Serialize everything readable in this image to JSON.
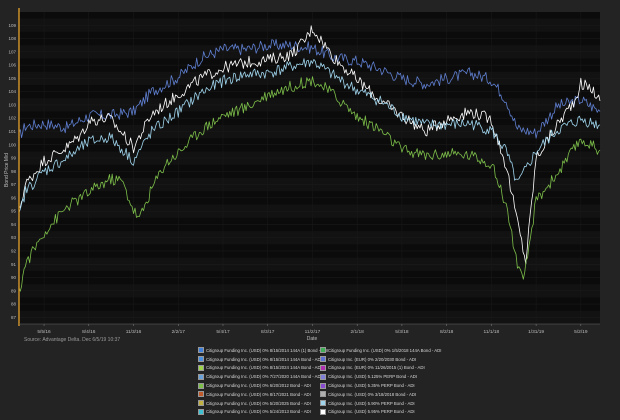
{
  "source_text": "Source: Advantage Delta. Dec 6/5/19 10:37",
  "chart_data": {
    "type": "line",
    "ylabel": "Bond Price Mid",
    "xlabel": "Date",
    "ylim": [
      86.5,
      110
    ],
    "y_ticks": [
      87,
      88,
      89,
      90,
      91,
      92,
      93,
      94,
      95,
      96,
      97,
      98,
      99,
      100,
      101,
      102,
      103,
      104,
      105,
      106,
      107,
      108,
      109
    ],
    "x_tick_labels": [
      "5/5/16",
      "8/4/16",
      "11/3/16",
      "2/2/17",
      "5/4/17",
      "8/3/17",
      "11/2/17",
      "2/1/18",
      "5/3/18",
      "8/2/18",
      "11/1/18",
      "1/31/19",
      "5/2/19"
    ],
    "x_range": [
      "3/15/16",
      "6/10/19"
    ],
    "grid": true,
    "series": [
      {
        "color": "#5f7fd0",
        "x": [
          "3/15/16",
          "3/28/16",
          "5/5/16",
          "6/20/16",
          "8/4/16",
          "9/15/16",
          "11/3/16",
          "12/10/16",
          "2/2/17",
          "3/20/17",
          "5/4/17",
          "6/20/17",
          "8/3/17",
          "9/20/17",
          "11/2/17",
          "12/15/17",
          "2/1/18",
          "3/20/18",
          "5/3/18",
          "6/20/18",
          "8/2/18",
          "9/20/18",
          "11/1/18",
          "12/1/18",
          "12/24/18",
          "1/31/19",
          "3/15/19",
          "5/2/19",
          "6/10/19"
        ],
        "values": [
          100.6,
          101.4,
          101.6,
          101.3,
          102.2,
          102.2,
          102.5,
          104.0,
          105.1,
          106.5,
          107.2,
          107.2,
          107.5,
          107.5,
          107.3,
          106.6,
          106.3,
          105.7,
          105.0,
          104.6,
          105.0,
          105.4,
          104.9,
          103.4,
          101.2,
          100.9,
          102.9,
          103.4,
          102.5
        ]
      },
      {
        "color": "#ffffff",
        "x": [
          "3/15/16",
          "3/28/16",
          "5/5/16",
          "6/20/16",
          "7/20/16",
          "8/4/16",
          "9/15/16",
          "10/10/16",
          "11/3/16",
          "12/10/16",
          "2/2/17",
          "3/20/17",
          "5/4/17",
          "6/20/17",
          "8/3/17",
          "9/20/17",
          "10/20/17",
          "11/2/17",
          "12/15/17",
          "2/1/18",
          "3/20/18",
          "5/3/18",
          "6/20/18",
          "8/2/18",
          "9/20/18",
          "11/1/18",
          "12/1/18",
          "12/24/18",
          "1/10/19",
          "1/31/19",
          "3/15/19",
          "4/20/19",
          "5/2/19",
          "5/25/19",
          "6/10/19"
        ],
        "values": [
          95.0,
          97.0,
          98.8,
          99.8,
          100.8,
          101.8,
          102.0,
          100.9,
          99.8,
          102.3,
          103.8,
          105.0,
          105.8,
          106.2,
          106.4,
          106.8,
          108.0,
          108.8,
          106.6,
          104.9,
          103.3,
          102.2,
          101.0,
          101.9,
          102.5,
          101.9,
          98.4,
          94.2,
          91.2,
          99.0,
          101.5,
          103.4,
          104.6,
          104.2,
          103.3
        ]
      },
      {
        "color": "#9fd4ec",
        "x": [
          "3/15/16",
          "3/28/16",
          "5/5/16",
          "6/20/16",
          "8/4/16",
          "9/15/16",
          "10/10/16",
          "11/3/16",
          "12/10/16",
          "2/2/17",
          "3/20/17",
          "5/4/17",
          "6/20/17",
          "8/3/17",
          "9/20/17",
          "11/2/17",
          "12/15/17",
          "2/1/18",
          "3/20/18",
          "5/3/18",
          "6/20/18",
          "8/2/18",
          "9/20/18",
          "11/1/18",
          "12/1/18",
          "12/24/18",
          "1/31/19",
          "3/15/19",
          "5/2/19",
          "6/10/19"
        ],
        "values": [
          94.5,
          96.5,
          98.0,
          99.0,
          100.2,
          100.6,
          99.7,
          98.8,
          101.0,
          102.5,
          103.9,
          104.8,
          105.3,
          105.4,
          105.9,
          106.3,
          105.2,
          104.1,
          103.3,
          102.2,
          101.5,
          101.5,
          101.6,
          101.1,
          99.5,
          97.0,
          99.5,
          101.1,
          101.9,
          101.5
        ]
      },
      {
        "color": "#7dbf4a",
        "x": [
          "3/15/16",
          "3/28/16",
          "5/5/16",
          "6/20/16",
          "8/4/16",
          "9/15/16",
          "10/10/16",
          "11/3/16",
          "11/15/16",
          "12/10/16",
          "1/5/17",
          "2/2/17",
          "3/20/17",
          "5/4/17",
          "6/20/17",
          "8/3/17",
          "9/20/17",
          "11/2/17",
          "12/15/17",
          "2/1/18",
          "3/20/18",
          "5/3/18",
          "6/20/18",
          "8/2/18",
          "9/20/18",
          "11/1/18",
          "12/1/18",
          "12/24/18",
          "1/5/19",
          "1/31/19",
          "3/15/19",
          "5/2/19",
          "5/25/19",
          "6/10/19"
        ],
        "values": [
          88.8,
          91.0,
          93.4,
          95.3,
          96.4,
          97.4,
          97.3,
          95.1,
          94.4,
          96.7,
          98.5,
          99.4,
          101.1,
          102.2,
          102.8,
          103.8,
          104.4,
          104.9,
          103.8,
          102.1,
          101.1,
          99.6,
          99.2,
          99.3,
          99.2,
          98.6,
          95.5,
          91.0,
          89.5,
          95.8,
          97.8,
          100.4,
          99.9,
          99.6
        ]
      }
    ]
  },
  "legend": [
    [
      "Citigroup Funding Inc. (USD) 0% 8/15/2014 144A (1) Bond - ADI",
      "Citigroup Funding Inc. (USD) 0% 1/5/2018 144A Bond - ADI"
    ],
    [
      "Citigroup Funding Inc. (USD) 0% 8/15/2014 144A Bond - ADI",
      "Citigroup Inc. (EUR) 0% 2/20/2030 Bond - ADI"
    ],
    [
      "Citigroup Funding Inc. (USD) 0% 8/15/2024 144A Bond - ADI",
      "Citigroup Inc. (EUR) 0% 11/26/2015 (1) Bond - ADI"
    ],
    [
      "Citigroup Funding Inc. (USD) 0% 7/27/2020 144A Bond - ADI",
      "Citigroup Inc. (USD) 5.125% PERP Bond - ADI"
    ],
    [
      "Citigroup Funding Inc. (USD) 0% 6/20/2012 Bond - ADI",
      "Citigroup Inc. (USD) 5.35% PERP Bond - ADI"
    ],
    [
      "Citigroup Funding Inc. (USD) 0% 8/17/2021 Bond - ADI",
      "Citigroup Inc. (USD) 0% 3/18/2018 Bond - ADI"
    ],
    [
      "Citigroup Funding Inc. (USD) 0% 5/20/2025 Bond - ADI",
      "Citigroup Inc. (USD) 5.90% PERP Bond - ADI"
    ],
    [
      "Citigroup Funding Inc. (USD) 0% 5/24/2013 Bond - ADI",
      "Citigroup Inc. (USD) 5.95% PERP Bond - ADI"
    ]
  ],
  "legend_colors": [
    [
      "#3f7fd9",
      "#3fae55"
    ],
    [
      "#4a8ee0",
      "#5b6fd0"
    ],
    [
      "#9fd44a",
      "#b02fb0"
    ],
    [
      "#6aa0d8",
      "#7f7fd8"
    ],
    [
      "#7dbf4a",
      "#8a4ad0"
    ],
    [
      "#c05a2a",
      "#b0b0b0"
    ],
    [
      "#c0b040",
      "#9fd4ec"
    ],
    [
      "#3fc0d0",
      "#ffffff"
    ]
  ]
}
